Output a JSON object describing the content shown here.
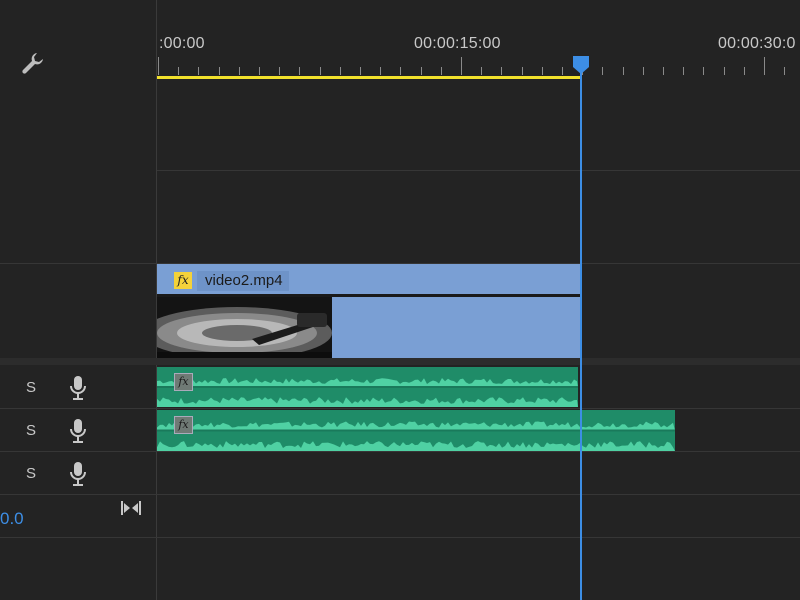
{
  "ruler": {
    "timecodes": [
      ":00:00",
      "00:00:15:00",
      "00:00:30:0"
    ]
  },
  "video_track": {
    "clip_name": "video2.mp4",
    "fx_label": "fx"
  },
  "audio_tracks": [
    {
      "solo_label": "S",
      "fx_label": "fx"
    },
    {
      "solo_label": "S",
      "fx_label": "fx"
    },
    {
      "solo_label": "S"
    }
  ],
  "master": {
    "volume_value": "0.0"
  },
  "colors": {
    "playhead": "#3d8ee5",
    "work_area": "#f2e12c",
    "video_clip": "#7a9fd4",
    "audio_clip": "#2aa57c"
  },
  "icons": {
    "settings": "wrench-icon",
    "voiceover": "microphone-icon",
    "fit": "fit-to-width-icon"
  }
}
